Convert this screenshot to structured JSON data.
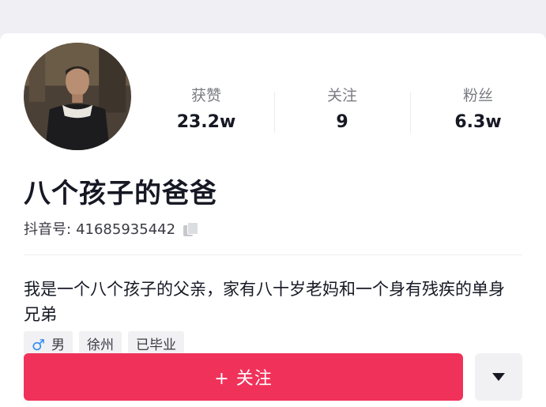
{
  "profile": {
    "nickname": "八个孩子的爸爸",
    "uid_label": "抖音号:",
    "uid_value": "41685935442",
    "bio": "我是一个八个孩子的父亲，家有八十岁老妈和一个身有残疾的单身兄弟"
  },
  "stats": [
    {
      "label": "获赞",
      "value": "23.2w"
    },
    {
      "label": "关注",
      "value": "9"
    },
    {
      "label": "粉丝",
      "value": "6.3w"
    }
  ],
  "tags": {
    "gender_icon": "♂",
    "gender": "男",
    "city": "徐州",
    "education": "已毕业"
  },
  "actions": {
    "follow_label": "+ 关注",
    "more_icon": "caret-down-icon"
  },
  "colors": {
    "accent": "#f0325a",
    "male_icon": "#2f8cf5"
  }
}
